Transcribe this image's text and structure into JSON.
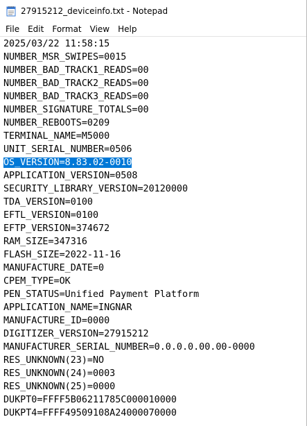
{
  "window": {
    "title": "27915212_deviceinfo.txt - Notepad",
    "icon": "notepad-icon"
  },
  "menu": [
    "File",
    "Edit",
    "Format",
    "View",
    "Help"
  ],
  "selection_color": "#0078d7",
  "editor": {
    "selected_line_index": 9,
    "lines": [
      "2025/03/22 11:58:15",
      "NUMBER_MSR_SWIPES=0015",
      "NUMBER_BAD_TRACK1_READS=00",
      "NUMBER_BAD_TRACK2_READS=00",
      "NUMBER_BAD_TRACK3_READS=00",
      "NUMBER_SIGNATURE_TOTALS=00",
      "NUMBER_REBOOTS=0209",
      "TERMINAL_NAME=M5000",
      "UNIT_SERIAL_NUMBER=0506",
      "OS_VERSION=8.83.02-0010",
      "APPLICATION_VERSION=0508",
      "SECURITY_LIBRARY_VERSION=20120000",
      "TDA_VERSION=0100",
      "EFTL_VERSION=0100",
      "EFTP_VERSION=374672",
      "RAM_SIZE=347316",
      "FLASH_SIZE=2022-11-16",
      "MANUFACTURE_DATE=0",
      "CPEM_TYPE=OK",
      "PEN_STATUS=Unified Payment Platform",
      "APPLICATION_NAME=INGNAR",
      "MANUFACTURE_ID=0000",
      "DIGITIZER_VERSION=27915212",
      "MANUFACTURER_SERIAL_NUMBER=0.0.0.0.00.00-0000",
      "RES_UNKNOWN(23)=NO",
      "RES_UNKNOWN(24)=0003",
      "RES_UNKNOWN(25)=0000",
      "DUKPT0=FFFF5B06211785C000010000",
      "DUKPT4=FFFF49509108A24000070000"
    ]
  }
}
